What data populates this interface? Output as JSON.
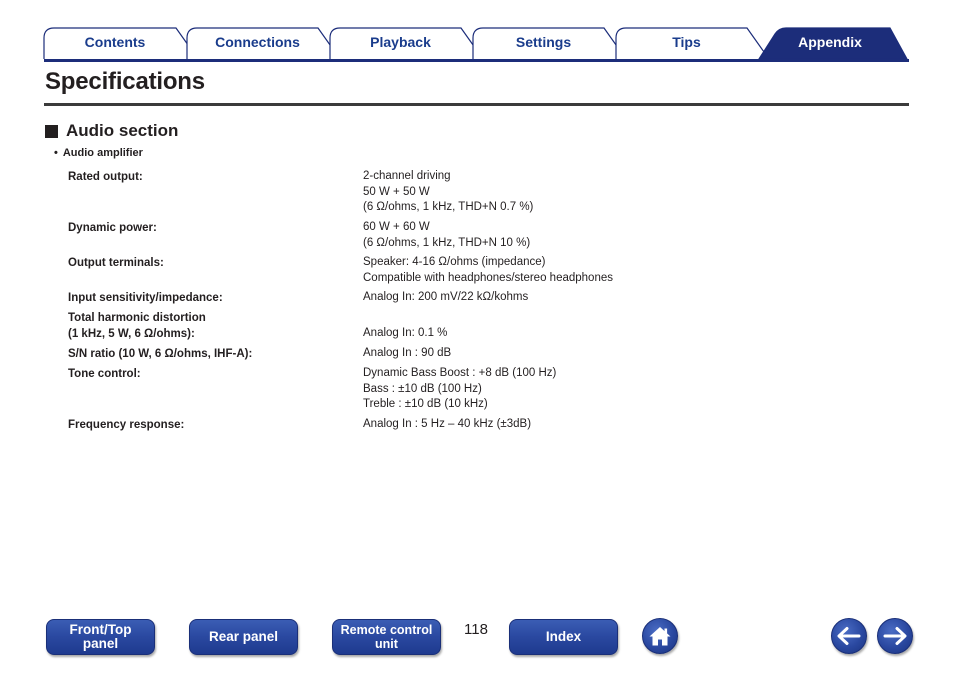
{
  "tabs": [
    {
      "label": "Contents",
      "active": false
    },
    {
      "label": "Connections",
      "active": false
    },
    {
      "label": "Playback",
      "active": false
    },
    {
      "label": "Settings",
      "active": false
    },
    {
      "label": "Tips",
      "active": false
    },
    {
      "label": "Appendix",
      "active": true
    }
  ],
  "colors": {
    "accent": "#1c2d7a",
    "tab_text": "#1a3c8c",
    "button_blue": "#2a48a0"
  },
  "page_title": "Specifications",
  "section": {
    "title": "Audio section",
    "subheading_bullet": "•",
    "subheading": "Audio amplifier",
    "rows": [
      {
        "label": [
          "Rated output:"
        ],
        "value": [
          "2-channel driving",
          "50 W + 50 W",
          "(6 Ω/ohms, 1 kHz, THD+N 0.7 %)"
        ]
      },
      {
        "label": [
          "Dynamic power:"
        ],
        "value": [
          "60 W + 60 W",
          "(6 Ω/ohms, 1 kHz, THD+N 10 %)"
        ]
      },
      {
        "label": [
          "Output terminals:"
        ],
        "value": [
          "Speaker: 4-16 Ω/ohms (impedance)",
          "Compatible with headphones/stereo headphones"
        ]
      },
      {
        "label": [
          "Input sensitivity/impedance:"
        ],
        "value": [
          "Analog In: 200 mV/22 kΩ/kohms"
        ]
      },
      {
        "label": [
          "Total harmonic distortion",
          "(1 kHz, 5 W, 6 Ω/ohms):"
        ],
        "value": [
          "Analog In: 0.1 %"
        ]
      },
      {
        "label": [
          "S/N ratio (10 W, 6 Ω/ohms, IHF-A):"
        ],
        "value": [
          "Analog In : 90 dB"
        ]
      },
      {
        "label": [
          "Tone control:"
        ],
        "value": [
          "Dynamic Bass Boost : +8 dB (100 Hz)",
          "Bass : ±10 dB (100 Hz)",
          "Treble : ±10 dB (10 kHz)"
        ]
      },
      {
        "label": [
          "Frequency response:"
        ],
        "value": [
          "Analog In : 5 Hz – 40 kHz (±3dB)"
        ]
      }
    ]
  },
  "footer": {
    "front_top_panel": [
      "Front/Top",
      "panel"
    ],
    "rear_panel": "Rear panel",
    "remote_control_unit": [
      "Remote control",
      "unit"
    ],
    "page_number": "118",
    "index": "Index",
    "home_icon": "home-icon",
    "back_icon": "arrow-left-icon",
    "forward_icon": "arrow-right-icon"
  }
}
